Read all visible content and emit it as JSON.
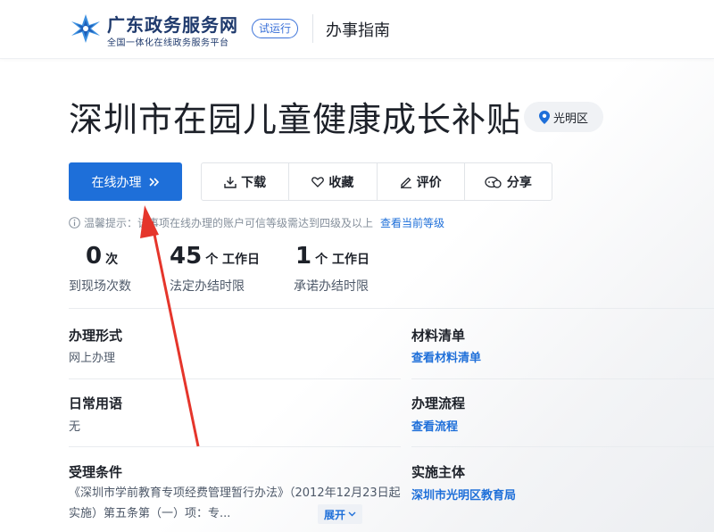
{
  "header": {
    "site_name": "广东政务服务网",
    "site_sub": "全国一体化在线政务服务平台",
    "trial_badge": "试运行",
    "guide": "办事指南"
  },
  "title": "深圳市在园儿童健康成长补贴",
  "region": "光明区",
  "buttons": {
    "online": "在线办理",
    "download": "下载",
    "favorite": "收藏",
    "rate": "评价",
    "share": "分享"
  },
  "tip": {
    "text": "温馨提示：该事项在线办理的账户可信等级需达到四级及以上",
    "link": "查看当前等级"
  },
  "stats": [
    {
      "num": "0",
      "unit": "次",
      "label": "到现场次数"
    },
    {
      "num": "45",
      "unit": "个 工作日",
      "label": "法定办结时限"
    },
    {
      "num": "1",
      "unit": "个 工作日",
      "label": "承诺办结时限"
    }
  ],
  "info": {
    "form_label": "办理形式",
    "form_value": "网上办理",
    "materials_label": "材料清单",
    "materials_link": "查看材料清单",
    "phrase_label": "日常用语",
    "phrase_value": "无",
    "process_label": "办理流程",
    "process_link": "查看流程",
    "conditions_label": "受理条件",
    "conditions_value": "《深圳市学前教育专项经费管理暂行办法》（2012年12月23日起实施）第五条第（一）项：专...",
    "implementer_label": "实施主体",
    "implementer_link": "深圳市光明区教育局",
    "expand": "展开"
  },
  "colors": {
    "primary": "#1e6fd9",
    "brand_navy": "#1f3a6d",
    "arrow": "#e5352b"
  },
  "icons": {
    "logo": "gov-logo-icon",
    "location": "location-pin-icon",
    "chevrons": "double-chevron-right-icon",
    "download": "download-icon",
    "favorite": "heart-icon",
    "rate": "pencil-icon",
    "share": "share-icon",
    "info": "info-circle-icon",
    "expand": "chevron-down-icon"
  }
}
